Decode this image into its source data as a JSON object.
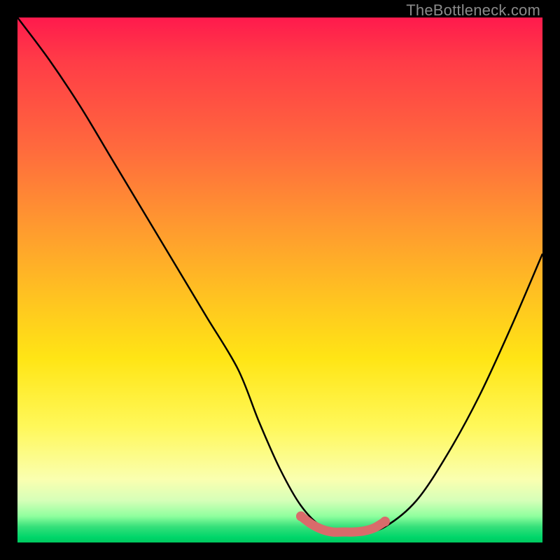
{
  "watermark": "TheBottleneck.com",
  "chart_data": {
    "type": "line",
    "title": "",
    "xlabel": "",
    "ylabel": "",
    "xlim": [
      0,
      100
    ],
    "ylim": [
      0,
      100
    ],
    "grid": false,
    "series": [
      {
        "name": "bottleneck-curve",
        "color": "#000000",
        "x": [
          0,
          6,
          12,
          18,
          24,
          30,
          36,
          42,
          46,
          50,
          54,
          58,
          62,
          66,
          70,
          76,
          82,
          88,
          94,
          100
        ],
        "y": [
          100,
          92,
          83,
          73,
          63,
          53,
          43,
          33,
          23,
          14,
          7,
          3,
          2,
          2,
          3,
          8,
          17,
          28,
          41,
          55
        ]
      },
      {
        "name": "bottleneck-flat-region",
        "color": "#e06666",
        "x": [
          54,
          56,
          58,
          60,
          62,
          64,
          66,
          68,
          70
        ],
        "y": [
          5,
          3.5,
          2.5,
          2,
          2,
          2,
          2.2,
          2.8,
          4
        ]
      }
    ]
  }
}
